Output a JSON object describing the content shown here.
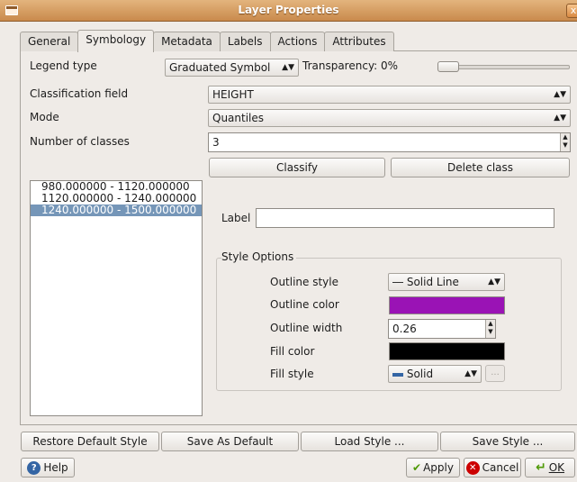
{
  "window": {
    "title": "Layer Properties",
    "close_glyph": "x"
  },
  "tabs": [
    {
      "label": "General"
    },
    {
      "label": "Symbology"
    },
    {
      "label": "Metadata"
    },
    {
      "label": "Labels"
    },
    {
      "label": "Actions"
    },
    {
      "label": "Attributes"
    }
  ],
  "legend": {
    "label": "Legend type",
    "value": "Graduated Symbol"
  },
  "transparency": {
    "label": "Transparency: 0%",
    "value": 0
  },
  "classification_field": {
    "label": "Classification field",
    "value": "HEIGHT"
  },
  "mode": {
    "label": "Mode",
    "value": "Quantiles"
  },
  "num_classes": {
    "label": "Number of classes",
    "value": "3"
  },
  "buttons": {
    "classify": "Classify",
    "delete_class": "Delete class"
  },
  "classes": [
    {
      "label": "980.000000 - 1120.000000",
      "selected": false
    },
    {
      "label": "1120.000000 - 1240.000000",
      "selected": false
    },
    {
      "label": "1240.000000 - 1500.000000",
      "selected": true
    }
  ],
  "label_field": {
    "label": "Label",
    "value": ""
  },
  "style_options": {
    "title": "Style Options",
    "outline_style": {
      "label": "Outline style",
      "value": "Solid Line"
    },
    "outline_color": {
      "label": "Outline color",
      "color": "#9a13b5"
    },
    "outline_width": {
      "label": "Outline width",
      "value": "0.26"
    },
    "fill_color": {
      "label": "Fill color",
      "color": "#000000"
    },
    "fill_style": {
      "label": "Fill style",
      "value": "Solid",
      "more": "..."
    }
  },
  "bottom_buttons": {
    "restore": "Restore Default Style",
    "save_default": "Save As Default",
    "load": "Load Style ...",
    "save": "Save Style ..."
  },
  "footer": {
    "help": "Help",
    "apply": "Apply",
    "cancel": "Cancel",
    "ok": "OK"
  }
}
